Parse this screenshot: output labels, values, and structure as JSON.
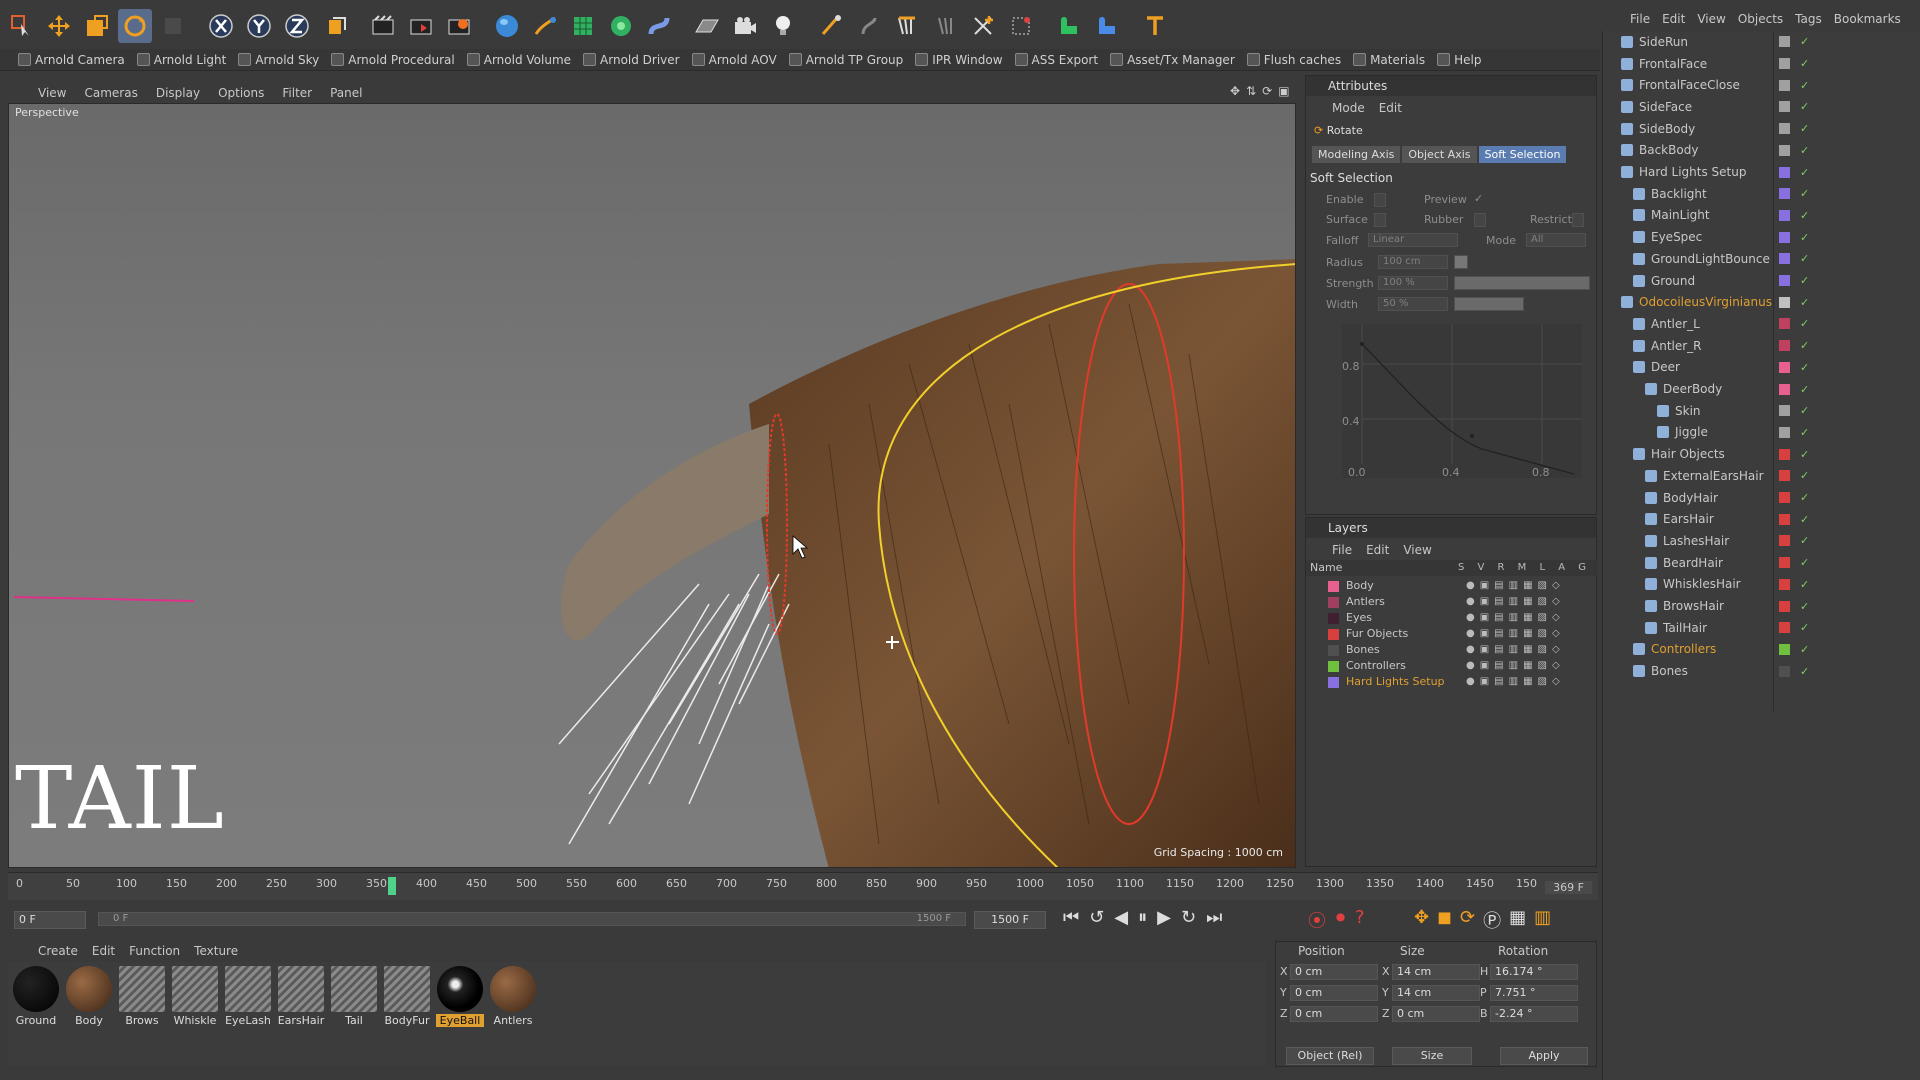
{
  "top_toolbar": {
    "icons": [
      "live-selection-icon",
      "move-icon",
      "scale-icon",
      "rotate-icon",
      "x-axis-icon",
      "y-axis-icon",
      "z-axis-icon",
      "coordinate-system-icon",
      "render-view-icon",
      "render-picture-viewer-icon",
      "render-settings-icon",
      "cube-icon",
      "pen-icon",
      "subdivision-icon",
      "array-icon",
      "deformer-icon",
      "floor-icon",
      "camera-icon",
      "light-icon"
    ]
  },
  "arnold_toolbar": {
    "items": [
      "Arnold Camera",
      "Arnold Light",
      "Arnold Sky",
      "Arnold Procedural",
      "Arnold Volume",
      "Arnold Driver",
      "Arnold AOV",
      "Arnold TP Group",
      "IPR Window",
      "ASS Export",
      "Asset/Tx Manager",
      "Flush caches",
      "Materials",
      "Help"
    ]
  },
  "viewport": {
    "menu": [
      "View",
      "Cameras",
      "Display",
      "Options",
      "Filter",
      "Panel"
    ],
    "label": "Perspective",
    "grid_spacing": "Grid Spacing : 1000 cm",
    "overlay_title": "TAIL"
  },
  "object_manager": {
    "menu": [
      "File",
      "Edit",
      "View",
      "Objects",
      "Tags",
      "Bookmarks"
    ],
    "rows": [
      {
        "name": "SideRun",
        "indent": 0
      },
      {
        "name": "FrontalFace",
        "indent": 0
      },
      {
        "name": "FrontalFaceClose",
        "indent": 0
      },
      {
        "name": "SideFace",
        "indent": 0
      },
      {
        "name": "SideBody",
        "indent": 0
      },
      {
        "name": "BackBody",
        "indent": 0
      },
      {
        "name": "Hard Lights Setup",
        "indent": 0
      },
      {
        "name": "Backlight",
        "indent": 1
      },
      {
        "name": "MainLight",
        "indent": 1
      },
      {
        "name": "EyeSpec",
        "indent": 1
      },
      {
        "name": "GroundLightBounce",
        "indent": 1
      },
      {
        "name": "Ground",
        "indent": 1
      },
      {
        "name": "OdocoileusVirginianus",
        "indent": 0
      },
      {
        "name": "Antler_L",
        "indent": 1
      },
      {
        "name": "Antler_R",
        "indent": 1
      },
      {
        "name": "Deer",
        "indent": 1
      },
      {
        "name": "DeerBody",
        "indent": 2
      },
      {
        "name": "Skin",
        "indent": 3
      },
      {
        "name": "Jiggle",
        "indent": 3
      },
      {
        "name": "Hair Objects",
        "indent": 1
      },
      {
        "name": "ExternalEarsHair",
        "indent": 2
      },
      {
        "name": "BodyHair",
        "indent": 2
      },
      {
        "name": "EarsHair",
        "indent": 2
      },
      {
        "name": "LashesHair",
        "indent": 2
      },
      {
        "name": "BeardHair",
        "indent": 2
      },
      {
        "name": "WhisklesHair",
        "indent": 2
      },
      {
        "name": "BrowsHair",
        "indent": 2
      },
      {
        "name": "TailHair",
        "indent": 2
      },
      {
        "name": "Controllers",
        "indent": 1
      },
      {
        "name": "Bones",
        "indent": 1
      }
    ]
  },
  "attributes": {
    "title": "Attributes",
    "menu": [
      "Mode",
      "Edit"
    ],
    "tool_name": "Rotate",
    "tabs": [
      "Modeling Axis",
      "Object Axis",
      "Soft Selection"
    ],
    "section": "Soft Selection",
    "enable_label": "Enable",
    "preview_label": "Preview",
    "surface_label": "Surface",
    "rubber_label": "Rubber",
    "restrict_label": "Restrict",
    "falloff_label": "Falloff",
    "falloff_value": "Linear",
    "mode_label": "Mode",
    "mode_value": "All",
    "radius_label": "Radius",
    "radius_value": "100 cm",
    "strength_label": "Strength",
    "strength_value": "100 %",
    "width_label": "Width",
    "width_value": "50 %",
    "graph_y_ticks": [
      "0.8",
      "0.4"
    ],
    "graph_x_ticks": [
      "0.0",
      "0.4",
      "0.8"
    ]
  },
  "layers": {
    "title": "Layers",
    "menu": [
      "File",
      "Edit",
      "View"
    ],
    "col_name": "Name",
    "col_flags": "S V R M L A G",
    "rows": [
      {
        "name": "Body",
        "color": "#e86090"
      },
      {
        "name": "Antlers",
        "color": "#a04060"
      },
      {
        "name": "Eyes",
        "color": "#402030"
      },
      {
        "name": "Fur Objects",
        "color": "#d84040"
      },
      {
        "name": "Bones",
        "color": "#505050"
      },
      {
        "name": "Controllers",
        "color": "#70c040"
      },
      {
        "name": "Hard Lights Setup",
        "color": "#8870e0"
      }
    ]
  },
  "timeline": {
    "ticks": [
      "0",
      "50",
      "100",
      "150",
      "200",
      "250",
      "300",
      "350",
      "400",
      "450",
      "500",
      "550",
      "600",
      "650",
      "700",
      "750",
      "800",
      "850",
      "900",
      "950",
      "1000",
      "1050",
      "1100",
      "1150",
      "1200",
      "1250",
      "1300",
      "1350",
      "1400",
      "1450",
      "150"
    ],
    "current_frame": 350,
    "end_readout": "369 F",
    "start_frame": "0 F",
    "range_start": "0 F",
    "range_end": "1500 F",
    "max_frame": "1500 F"
  },
  "material_manager": {
    "menu": [
      "Create",
      "Edit",
      "Function",
      "Texture"
    ],
    "materials": [
      {
        "name": "Ground",
        "kind": "black"
      },
      {
        "name": "Body",
        "kind": "brown"
      },
      {
        "name": "Brows",
        "kind": "hair"
      },
      {
        "name": "Whiskle",
        "kind": "hair"
      },
      {
        "name": "EyeLash",
        "kind": "hair"
      },
      {
        "name": "EarsHair",
        "kind": "hair"
      },
      {
        "name": "Tail",
        "kind": "hair"
      },
      {
        "name": "BodyFur",
        "kind": "hair"
      },
      {
        "name": "EyeBall",
        "kind": "eye"
      },
      {
        "name": "Antlers",
        "kind": "brown"
      }
    ],
    "selected": "EyeBall"
  },
  "coordinates": {
    "headers": [
      "Position",
      "Size",
      "Rotation"
    ],
    "rows": [
      {
        "pos_axis": "X",
        "pos": "0 cm",
        "size_axis": "X",
        "size": "14 cm",
        "rot_axis": "H",
        "rot": "16.174 °"
      },
      {
        "pos_axis": "Y",
        "pos": "0 cm",
        "size_axis": "Y",
        "size": "14 cm",
        "rot_axis": "P",
        "rot": "7.751 °"
      },
      {
        "pos_axis": "Z",
        "pos": "0 cm",
        "size_axis": "Z",
        "size": "0 cm",
        "rot_axis": "B",
        "rot": "-2.24 °"
      }
    ],
    "mode_select": "Object (Rel)",
    "size_select": "Size",
    "apply_label": "Apply"
  },
  "colors": {
    "accent": "#5a7cb0",
    "selection": "#e0a030",
    "playhead": "#4fd28a",
    "fur": "#6a4a30"
  }
}
